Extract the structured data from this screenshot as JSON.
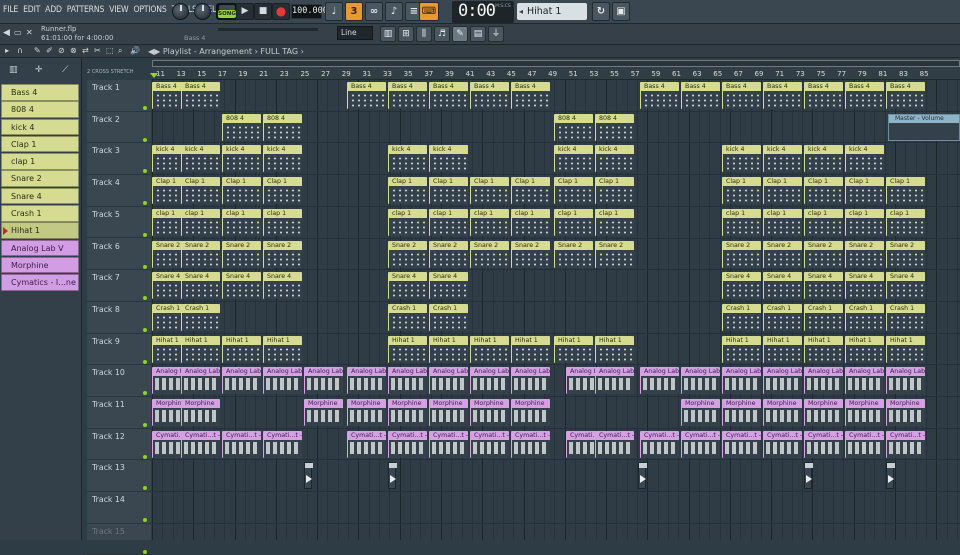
{
  "menu": [
    "FILE",
    "EDIT",
    "ADD",
    "PATTERNS",
    "VIEW",
    "OPTIONS",
    "TOOLS",
    "HELP"
  ],
  "transport": {
    "mode": "SONG",
    "tempo": "100.000",
    "time": "0:00",
    "time_sub": "M:S:CS"
  },
  "pattern_selector": "Hihat 1",
  "hint": {
    "file": "Runner.flp",
    "position": "61:01:00 for 4:00:00"
  },
  "bar2_label": "Bass 4",
  "snap": "Line",
  "playlist": {
    "title": "Playlist - Arrangement",
    "arrangement": "FULL TAG"
  },
  "ruler_label": "2 CROSS  STRETCH",
  "bar_numbers": [
    "11",
    "13",
    "15",
    "17",
    "19",
    "21",
    "23",
    "25",
    "27",
    "29",
    "31",
    "33",
    "35",
    "37",
    "39",
    "41",
    "43",
    "45",
    "47",
    "49",
    "51",
    "53",
    "55",
    "57",
    "59",
    "61",
    "63",
    "65",
    "67",
    "69",
    "71",
    "73",
    "75",
    "77",
    "79",
    "81",
    "83",
    "85"
  ],
  "patterns": [
    {
      "label": "Bass 4",
      "kind": "y"
    },
    {
      "label": "808 4",
      "kind": "y"
    },
    {
      "label": "kick 4",
      "kind": "y"
    },
    {
      "label": "Clap 1",
      "kind": "y"
    },
    {
      "label": "clap 1",
      "kind": "y"
    },
    {
      "label": "Snare 2",
      "kind": "y"
    },
    {
      "label": "Snare 4",
      "kind": "y"
    },
    {
      "label": "Crash 1",
      "kind": "y"
    },
    {
      "label": "Hihat 1",
      "kind": "y",
      "selected": true
    },
    {
      "label": "Analog Lab V",
      "kind": "p"
    },
    {
      "label": "Morphine",
      "kind": "p"
    },
    {
      "label": "Cymatics - I...ne Shot - C",
      "kind": "p"
    }
  ],
  "tracks": [
    "Track 1",
    "Track 2",
    "Track 3",
    "Track 4",
    "Track 5",
    "Track 6",
    "Track 7",
    "Track 8",
    "Track 9",
    "Track 10",
    "Track 11",
    "Track 12",
    "Track 13",
    "Track 14",
    "Track 15"
  ],
  "automation_label": "Master - Volume",
  "clips": [
    {
      "t": 0,
      "k": "y",
      "l": "Bass 4",
      "x": [
        0,
        29,
        195,
        236,
        277,
        318,
        359,
        488,
        529,
        570,
        611,
        652,
        693,
        734
      ]
    },
    {
      "t": 1,
      "k": "y",
      "l": "808 4",
      "x": [
        70,
        111,
        402,
        443
      ]
    },
    {
      "t": 2,
      "k": "y",
      "l": "kick 4",
      "x": [
        0,
        29,
        70,
        111,
        236,
        277,
        402,
        443,
        570,
        611,
        652,
        693
      ]
    },
    {
      "t": 3,
      "k": "y",
      "l": "Clap 1",
      "x": [
        0,
        29,
        70,
        111,
        236,
        277,
        318,
        359,
        402,
        443,
        570,
        611,
        652,
        693,
        734
      ]
    },
    {
      "t": 4,
      "k": "y",
      "l": "clap 1",
      "x": [
        0,
        29,
        70,
        111,
        236,
        277,
        318,
        359,
        402,
        443,
        570,
        611,
        652,
        693,
        734
      ]
    },
    {
      "t": 5,
      "k": "y",
      "l": "Snare 2",
      "x": [
        0,
        29,
        70,
        111,
        236,
        277,
        318,
        359,
        402,
        443,
        570,
        611,
        652,
        693,
        734
      ]
    },
    {
      "t": 6,
      "k": "y",
      "l": "Snare 4",
      "x": [
        0,
        29,
        70,
        111,
        236,
        277,
        570,
        611,
        652,
        693,
        734
      ]
    },
    {
      "t": 7,
      "k": "y",
      "l": "Crash 1",
      "x": [
        0,
        29,
        236,
        277,
        570,
        611,
        652,
        693,
        734
      ]
    },
    {
      "t": 8,
      "k": "y",
      "l": "Hihat 1",
      "x": [
        0,
        29,
        70,
        111,
        236,
        277,
        318,
        359,
        402,
        443,
        570,
        611,
        652,
        693,
        734
      ]
    },
    {
      "t": 9,
      "k": "p",
      "l": "Analog Lab V",
      "x": [
        0,
        29,
        70,
        111,
        152,
        195,
        236,
        277,
        318,
        359,
        414,
        443,
        488,
        529,
        570,
        611,
        652,
        693,
        734
      ]
    },
    {
      "t": 10,
      "k": "p",
      "l": "Morphine",
      "x": [
        0,
        29,
        152,
        195,
        236,
        277,
        318,
        359,
        529,
        570,
        611,
        652,
        693,
        734
      ]
    },
    {
      "t": 11,
      "k": "p",
      "l": "Cymati...t - C",
      "x": [
        0,
        29,
        70,
        111,
        195,
        236,
        277,
        318,
        359,
        414,
        443,
        488,
        529,
        570,
        611,
        652,
        693,
        734
      ]
    }
  ]
}
